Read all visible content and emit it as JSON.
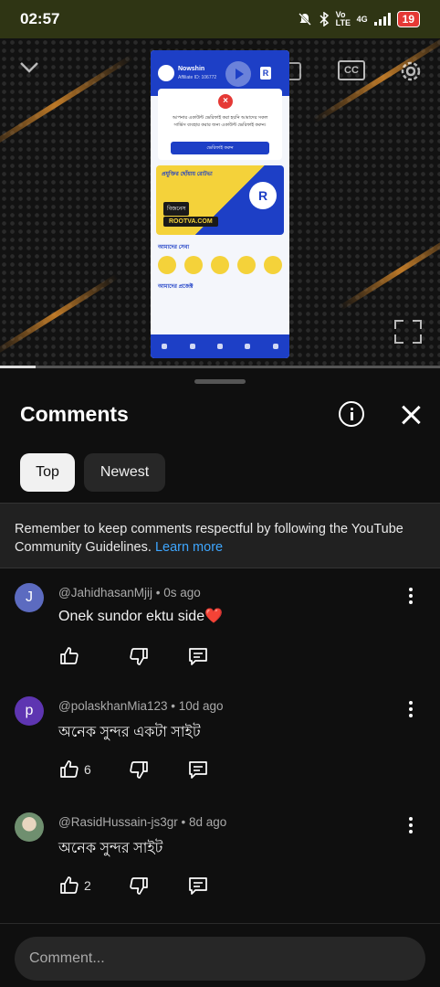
{
  "status_bar": {
    "time": "02:57",
    "icons": [
      "mute-icon",
      "bluetooth-icon",
      "volte-icon",
      "4g-icon",
      "signal-icon"
    ],
    "network_label": "4G",
    "volte_label": "Vo LTE",
    "battery": "19",
    "bar_color": "#2f3514"
  },
  "video": {
    "controls": [
      "chevron-down-icon",
      "cast-icon",
      "cc-icon",
      "settings-icon",
      "fullscreen-icon"
    ],
    "cc_label": "CC",
    "phone_mockup": {
      "name": "Nowshin",
      "sub": "Affiliate ID: 106772",
      "card_text": "আপনার একাউন্ট ভেরিফাই করা হয়নি আমাদের সকল সার্ভিস ব্যবহার করার জন্য একাউন্ট ভেরিফাই করুন।",
      "card_button": "ভেরিফাই করুন",
      "banner_title": "প্রযুক্তির ছোঁয়ায় রোটভা",
      "banner_tag": "বিজনেস",
      "banner_url": "ROOTVA.COM",
      "banner_logo": "R",
      "section_1": "আমাদের সেবা",
      "section_2": "আমাদের প্রজেক্ট",
      "accent": "#1d3fc6"
    },
    "progress": 0.08
  },
  "sheet": {
    "title": "Comments",
    "filters": [
      {
        "label": "Top",
        "selected": true
      },
      {
        "label": "Newest",
        "selected": false
      }
    ],
    "guidelines_text": "Remember to keep comments respectful by following the YouTube Community Guidelines.",
    "learn_more": "Learn more",
    "comments": [
      {
        "avatar_letter": "J",
        "avatar_color": "#5c6bc0",
        "author": "@JahidhasanMjij",
        "time": "0s ago",
        "text": "Onek sundor ektu side",
        "emoji": "❤️",
        "likes": ""
      },
      {
        "avatar_letter": "p",
        "avatar_color": "#5e35b1",
        "author": "@polaskhanMia123",
        "time": "10d ago",
        "text": "অনেক সুন্দর একটা সাইট",
        "emoji": "",
        "likes": "6"
      },
      {
        "avatar_letter": "",
        "avatar_color": "#8aa28a",
        "author": "@RasidHussain-js3gr",
        "time": "8d ago",
        "text": "অনেক সুন্দর সাইট",
        "emoji": "",
        "likes": "2"
      }
    ],
    "comment_placeholder": "Comment..."
  },
  "colors": {
    "background": "#0f0f0f",
    "link": "#3ea6ff",
    "heart": "#e53935"
  }
}
